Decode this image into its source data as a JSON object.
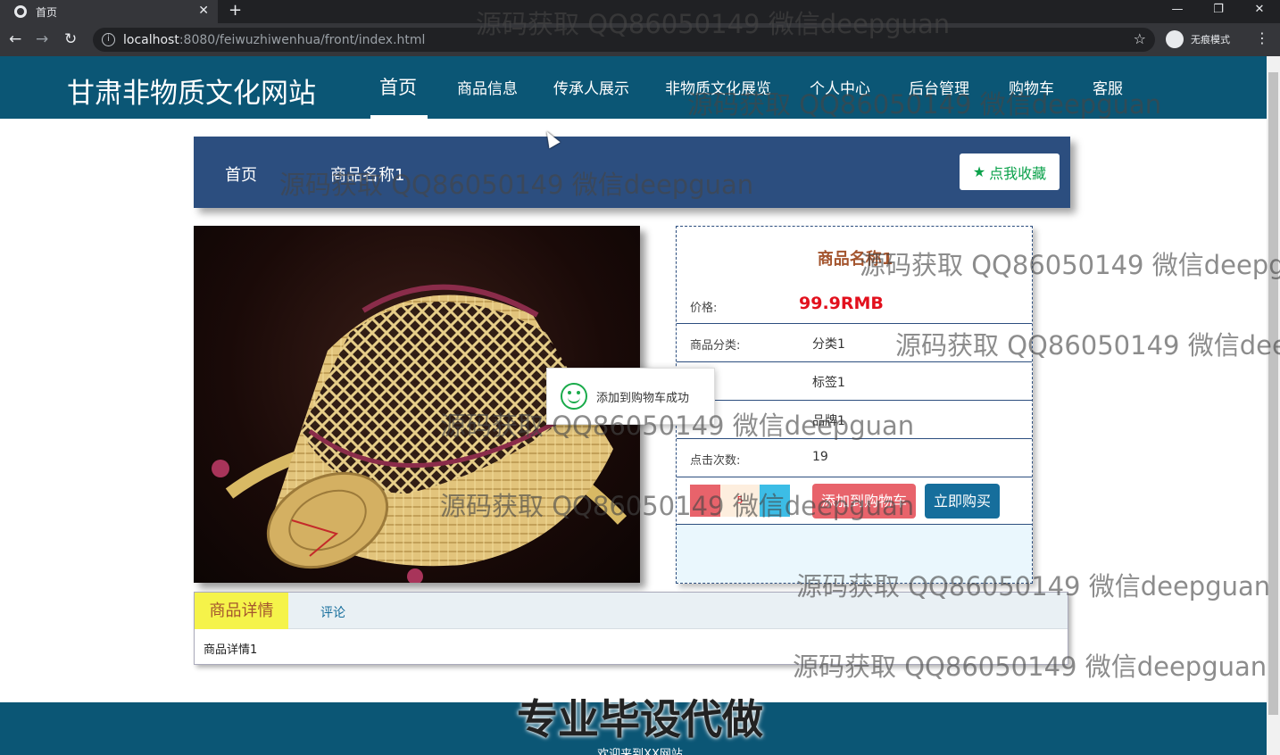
{
  "browser": {
    "tab_title": "首页",
    "tab_close": "✕",
    "new_tab": "+",
    "window_controls": [
      "—",
      "❐",
      "✕"
    ],
    "url_host": "localhost",
    "url_path": ":8080/feiwuzhiwenhua/front/index.html",
    "incognito_label": "无痕模式"
  },
  "header": {
    "brand": "甘肃非物质文化网站",
    "nav": [
      "首页",
      "商品信息",
      "传承人展示",
      "非物质文化展览",
      "个人中心",
      "后台管理",
      "购物车",
      "客服"
    ]
  },
  "breadcrumb": {
    "home": "首页",
    "current": "商品名称1",
    "favorite_label": "点我收藏"
  },
  "product": {
    "title": "商品名称1",
    "price_label": "价格:",
    "price_value": "99.9RMB",
    "rows": [
      {
        "label": "商品分类:",
        "value": "分类1"
      },
      {
        "label": ":",
        "value": "标签1"
      },
      {
        "label": ":",
        "value": "品牌1"
      },
      {
        "label": "点击次数:",
        "value": "19"
      }
    ],
    "quantity": "5",
    "add_cart_label": "添加到购物车",
    "buy_label": "立即购买"
  },
  "toast": {
    "message": "添加到购物车成功"
  },
  "tabs": {
    "detail_label": "商品详情",
    "comment_label": "评论",
    "detail_content": "商品详情1"
  },
  "footer": {
    "promo": "专业毕设代做",
    "welcome": "欢迎来到XX网站"
  },
  "watermark": {
    "text": "源码获取 QQ86050149 微信deepguan"
  },
  "colors": {
    "header_bg": "#0b5675",
    "breadcrumb_bg": "#2c4e7f",
    "price": "#e2101d",
    "title": "#a4552e",
    "cart_btn": "#e8636b",
    "buy_btn": "#166e9c",
    "favorite_text": "#0aa14a"
  }
}
